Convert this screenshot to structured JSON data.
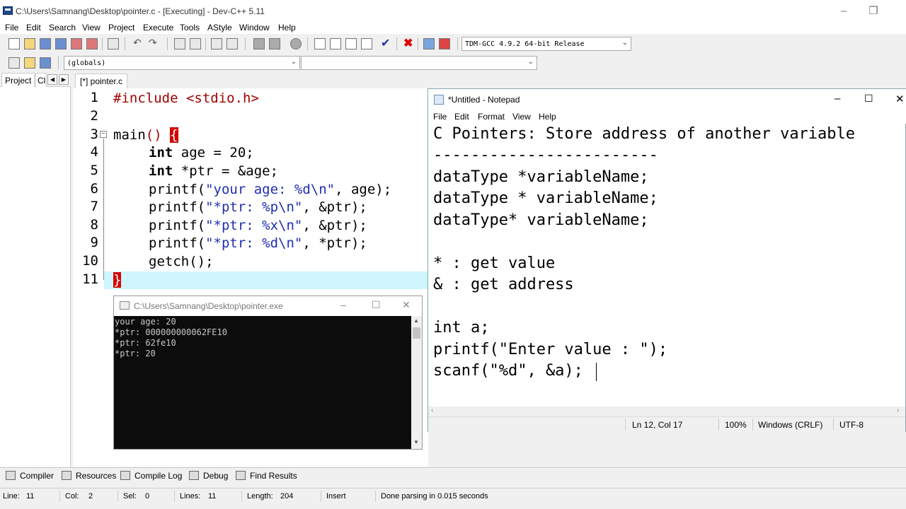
{
  "devcpp": {
    "title": "C:\\Users\\Samnang\\Desktop\\pointer.c - [Executing] - Dev-C++ 5.11",
    "menu": [
      "File",
      "Edit",
      "Search",
      "View",
      "Project",
      "Execute",
      "Tools",
      "AStyle",
      "Window",
      "Help"
    ],
    "compiler_select": "TDM-GCC 4.9.2 64-bit Release",
    "scope_select": "(globals)",
    "left_tabs": [
      "Project",
      "Cl"
    ],
    "editor_tab": "[*] pointer.c",
    "line_numbers": [
      "1",
      "2",
      "3",
      "4",
      "5",
      "6",
      "7",
      "8",
      "9",
      "10",
      "11"
    ],
    "code": {
      "l1": "#include <stdio.h>",
      "l3a": "main",
      "l3b": "()",
      "l3c": "{",
      "l4_kw": "int",
      "l4_rest": " age = 20;",
      "l5_kw": "int",
      "l5_rest": " *ptr = &age;",
      "l6a": "printf(",
      "l6b": "\"your age: %d\\n\"",
      "l6c": ", age);",
      "l7a": "printf(",
      "l7b": "\"*ptr: %p\\n\"",
      "l7c": ", &ptr);",
      "l8a": "printf(",
      "l8b": "\"*ptr: %x\\n\"",
      "l8c": ", &ptr);",
      "l9a": "printf(",
      "l9b": "\"*ptr: %d\\n\"",
      "l9c": ", *ptr);",
      "l10": "getch();",
      "l11": "}"
    }
  },
  "console": {
    "title": "C:\\Users\\Samnang\\Desktop\\pointer.exe",
    "lines": [
      "your age: 20",
      "*ptr: 000000000062FE10",
      "*ptr: 62fe10",
      "*ptr: 20"
    ]
  },
  "notepad": {
    "title": "*Untitled - Notepad",
    "menu": [
      "File",
      "Edit",
      "Format",
      "View",
      "Help"
    ],
    "lines": [
      "C Pointers: Store address of another variable",
      "------------------------",
      "dataType *variableName;",
      "dataType * variableName;",
      "dataType* variableName;",
      "",
      "* : get value",
      "& : get address",
      "",
      "int a;",
      "printf(\"Enter value : \");",
      "scanf(\"%d\", &a);"
    ],
    "status": {
      "position": "Ln 12, Col 17",
      "zoom": "100%",
      "line_ending": "Windows (CRLF)",
      "encoding": "UTF-8"
    }
  },
  "bottom_tabs": [
    "Compiler",
    "Resources",
    "Compile Log",
    "Debug",
    "Find Results"
  ],
  "statusbar": {
    "line_label": "Line:",
    "line_value": "11",
    "col_label": "Col:",
    "col_value": "2",
    "sel_label": "Sel:",
    "sel_value": "0",
    "lines_label": "Lines:",
    "lines_value": "11",
    "length_label": "Length:",
    "length_value": "204",
    "mode": "Insert",
    "message": "Done parsing in 0.015 seconds"
  }
}
